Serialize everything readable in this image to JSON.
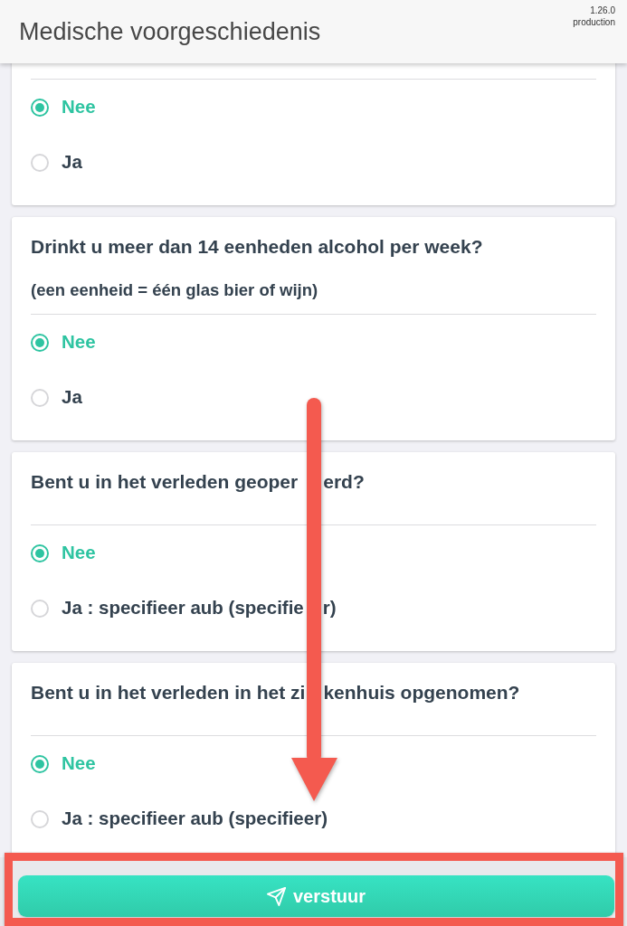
{
  "header": {
    "title": "Medische voorgeschiedenis",
    "version": "1.26.0",
    "environment": "production"
  },
  "questions": [
    {
      "options": [
        {
          "label": "Nee",
          "selected": true
        },
        {
          "label": "Ja",
          "selected": false
        }
      ]
    },
    {
      "question": "Drinkt u meer dan 14 eenheden alcohol per week?",
      "note": "(een eenheid = één glas bier of wijn)",
      "options": [
        {
          "label": "Nee",
          "selected": true
        },
        {
          "label": "Ja",
          "selected": false
        }
      ]
    },
    {
      "question": [
        "Bent u in het verleden geoper",
        "erd?"
      ],
      "options": [
        {
          "label": "Nee",
          "selected": true
        },
        {
          "label": [
            "Ja : specifieer aub (specifie",
            "r)"
          ],
          "selected": false
        }
      ]
    },
    {
      "question": [
        "Bent u in het verleden in het zi",
        "kenhuis opgenomen?"
      ],
      "options": [
        {
          "label": "Nee",
          "selected": true
        },
        {
          "label": "Ja : specifieer aub (specifieer)",
          "selected": false
        }
      ]
    }
  ],
  "submit_button": {
    "label": "verstuur"
  },
  "annotations": {
    "arrow": true,
    "frame": true
  }
}
